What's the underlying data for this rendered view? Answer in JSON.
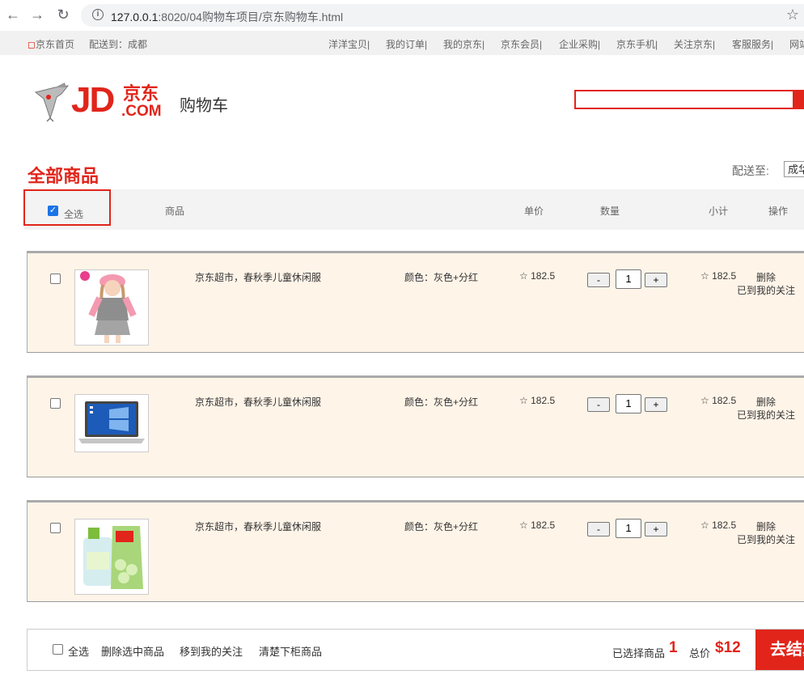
{
  "browser": {
    "url_host": "127.0.0.1",
    "url_rest": ":8020/04购物车项目/京东购物车.html"
  },
  "shortcut": {
    "home": "京东首页",
    "deliver_to": "配送到：成都",
    "links": [
      "洋洋宝贝|",
      "我的订单|",
      "我的京东|",
      "京东会员|",
      "企业采购|",
      "京东手机|",
      "关注京东|",
      "客服服务|",
      "网站"
    ]
  },
  "header": {
    "logo_jd": "JD",
    "logo_cn": "京东",
    "logo_com": ".COM",
    "cart_title": "购物车"
  },
  "section": {
    "title": "全部商品",
    "deliver_label": "配送至:",
    "deliver_value": "成华"
  },
  "table_header": {
    "select_all": "全选",
    "goods": "商品",
    "unit_price": "单价",
    "quantity": "数量",
    "subtotal": "小计",
    "action": "操作"
  },
  "items": [
    {
      "name": "京东超市，春秋季儿童休闲服",
      "attr": "颜色：灰色+分红",
      "price": "☆ 182.5",
      "minus": "-",
      "qty": "1",
      "plus": "+",
      "subtotal": "☆ 182.5",
      "delete": "删除",
      "move": "已到我的关注",
      "image": "girl-clothing"
    },
    {
      "name": "京东超市，春秋季儿童休闲服",
      "attr": "颜色：灰色+分红",
      "price": "☆ 182.5",
      "minus": "-",
      "qty": "1",
      "plus": "+",
      "subtotal": "☆ 182.5",
      "delete": "删除",
      "move": "已到我的关注",
      "image": "laptop"
    },
    {
      "name": "京东超市，春秋季儿童休闲服",
      "attr": "颜色：灰色+分红",
      "price": "☆ 182.5",
      "minus": "-",
      "qty": "1",
      "plus": "+",
      "subtotal": "☆ 182.5",
      "delete": "删除",
      "move": "已到我的关注",
      "image": "detergent"
    }
  ],
  "footer": {
    "select_all": "全选",
    "delete_selected": "删除选中商品",
    "move_to_fav": "移到我的关注",
    "clear": "清楚下柜商品",
    "selected_label": "已选择商品",
    "selected_count": "1",
    "total_label": "总价",
    "total": "$12",
    "checkout": "去结算"
  },
  "colors": {
    "brand_red": "#e1251b",
    "item_bg": "#fff4e8"
  }
}
